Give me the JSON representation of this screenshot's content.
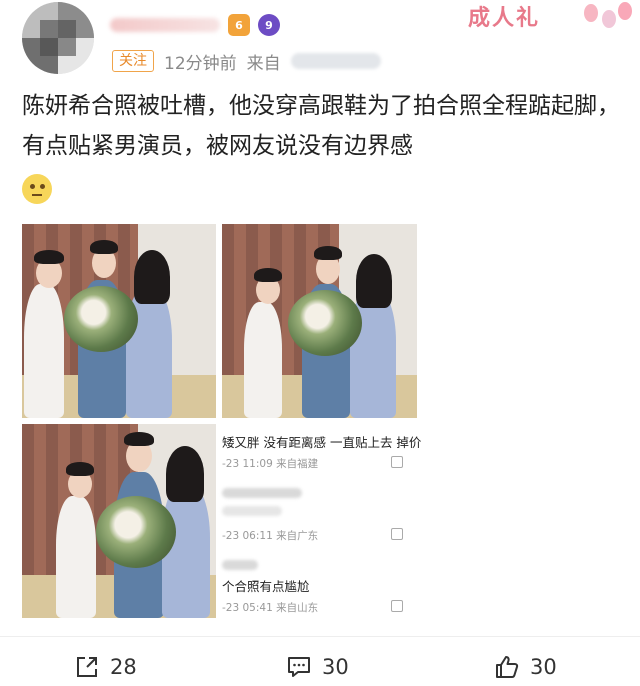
{
  "post": {
    "follow_label": "关注",
    "time": "12分钟前",
    "source_prefix": "来自",
    "text": "陈妍希合照被吐槽，他没穿高跟鞋为了拍合照全程踮起脚，有点贴紧男演员，被网友说没有边界感",
    "emoji_icon": "thinking-face-icon"
  },
  "header_decoration": {
    "gift_text": "成人礼"
  },
  "badges": [
    "6",
    "9"
  ],
  "comments": [
    {
      "text": "矮又胖 没有距离感 一直贴上去 掉价",
      "meta": "-23 11:09 来自福建"
    },
    {
      "text": "",
      "meta": "-23 06:11 来自广东"
    },
    {
      "text": "个合照有点尴尬",
      "meta": "-23 05:41 来自山东"
    }
  ],
  "actions": {
    "repost_count": "28",
    "comment_count": "30",
    "like_count": "30"
  },
  "colors": {
    "follow_orange": "#e88a2b",
    "gift_pink": "#e8798a"
  }
}
